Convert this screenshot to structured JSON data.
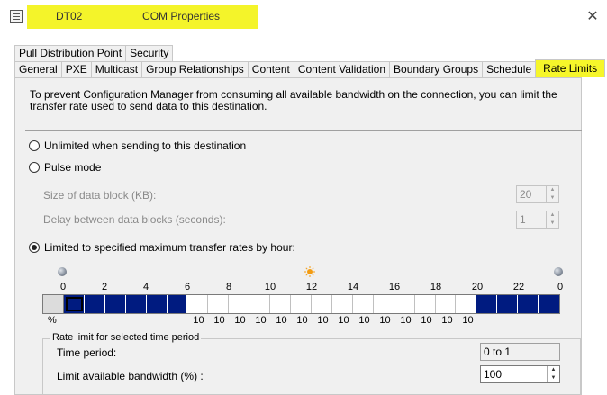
{
  "window": {
    "title": "DT02                    COM Properties",
    "close_glyph": "✕",
    "icon": "properties-window-icon"
  },
  "tabs_row1": [
    {
      "label": "Pull Distribution Point"
    },
    {
      "label": "Security"
    }
  ],
  "tabs_row2": [
    {
      "label": "General"
    },
    {
      "label": "PXE"
    },
    {
      "label": "Multicast"
    },
    {
      "label": "Group Relationships"
    },
    {
      "label": "Content"
    },
    {
      "label": "Content Validation"
    },
    {
      "label": "Boundary Groups"
    },
    {
      "label": "Schedule"
    },
    {
      "label": "Rate Limits",
      "active": true
    }
  ],
  "intro_text": "To prevent Configuration Manager from consuming all available bandwidth on the connection, you can  limit the transfer rate used to send data to this destination.",
  "options": {
    "unlimited": "Unlimited when sending to this destination",
    "pulse": "Pulse mode",
    "limited": "Limited to specified maximum transfer rates by hour:",
    "selected": "limited"
  },
  "pulse_settings": {
    "block_size_label": "Size of data block (KB):",
    "block_size_value": "20",
    "delay_label": "Delay between data blocks (seconds):",
    "delay_value": "1"
  },
  "schedule": {
    "hour_labels": [
      "0",
      "2",
      "4",
      "6",
      "8",
      "10",
      "12",
      "14",
      "16",
      "18",
      "20",
      "22",
      "0"
    ],
    "pct_label": "%",
    "slot_values": [
      "",
      "",
      "",
      "",
      "",
      "",
      "10",
      "10",
      "10",
      "10",
      "10",
      "10",
      "10",
      "10",
      "10",
      "10",
      "10",
      "10",
      "10",
      "10",
      "",
      "",
      "",
      ""
    ],
    "slot_levels": [
      100,
      100,
      100,
      100,
      100,
      100,
      10,
      10,
      10,
      10,
      10,
      10,
      10,
      10,
      10,
      10,
      10,
      10,
      10,
      10,
      100,
      100,
      100,
      100
    ],
    "selected_slot": 0,
    "colors": {
      "full": "#001b80",
      "low": "#ffffff"
    }
  },
  "rate_group": {
    "legend": "Rate limit for selected time period",
    "time_period_label": "Time period:",
    "time_period_value": "0 to 1",
    "bandwidth_label": "Limit available bandwidth (%) :",
    "bandwidth_value": "100"
  }
}
